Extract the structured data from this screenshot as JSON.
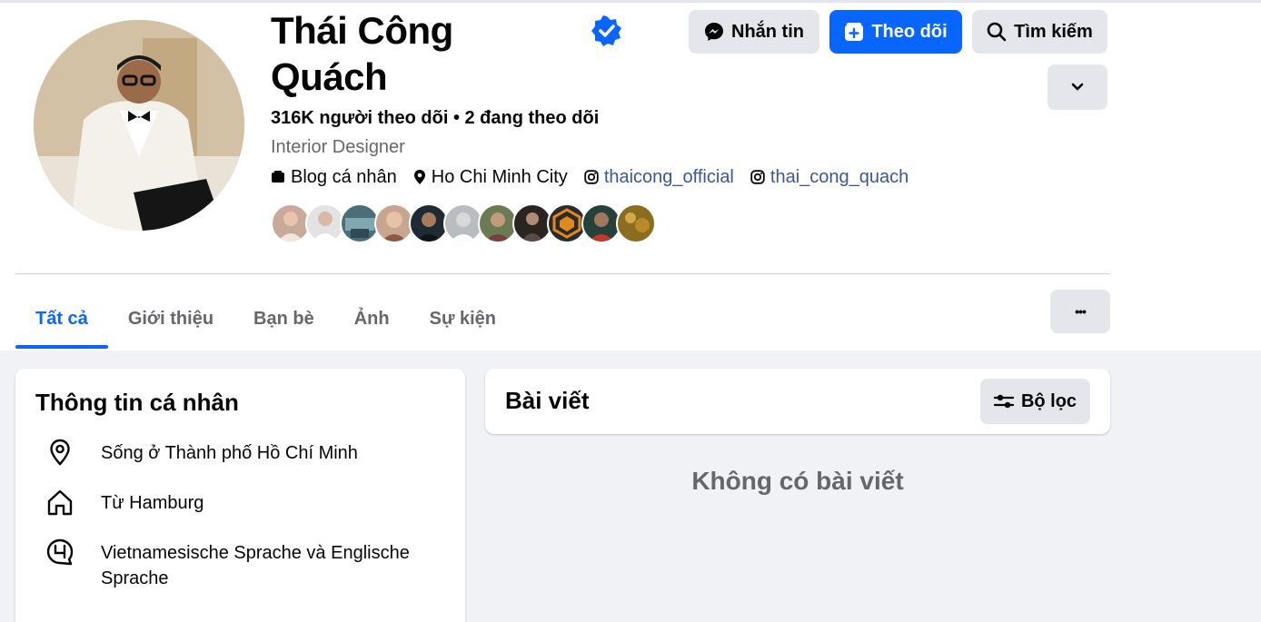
{
  "profile": {
    "name": "Thái Công Quách",
    "followers_line": "316K người theo dõi • 2 đang theo dõi",
    "category": "Interior Designer",
    "details": [
      {
        "icon": "blog-icon",
        "label": "Blog cá nhân"
      },
      {
        "icon": "location-pin-icon",
        "label": "Ho Chi Minh City"
      },
      {
        "icon": "instagram-icon",
        "label": "thaicong_official"
      },
      {
        "icon": "instagram-icon",
        "label": "thai_cong_quach"
      }
    ]
  },
  "actions": {
    "message_label": "Nhắn tin",
    "follow_label": "Theo dõi",
    "search_label": "Tìm kiếm"
  },
  "tabs": [
    {
      "label": "Tất cả",
      "active": true
    },
    {
      "label": "Giới thiệu"
    },
    {
      "label": "Bạn bè"
    },
    {
      "label": "Ảnh"
    },
    {
      "label": "Sự kiện"
    }
  ],
  "more_label": "•••",
  "intro": {
    "title": "Thông tin cá nhân",
    "items": [
      {
        "icon": "location-pin-icon",
        "text": "Sống ở Thành phố Hồ Chí Minh"
      },
      {
        "icon": "home-icon",
        "text": "Từ Hamburg"
      },
      {
        "icon": "language-icon",
        "text_parts": [
          "Vietnamesische Sprache",
          " và ",
          "Englische Sprache"
        ]
      }
    ]
  },
  "posts": {
    "title": "Bài viết",
    "filter_label": "Bộ lọc",
    "empty_text": "Không có bài viết"
  },
  "colors": {
    "accent": "#0866ff",
    "link": "#385898",
    "secondary_text": "#65676b",
    "button_bg": "#e4e6eb",
    "page_bg": "#f0f2f5"
  }
}
